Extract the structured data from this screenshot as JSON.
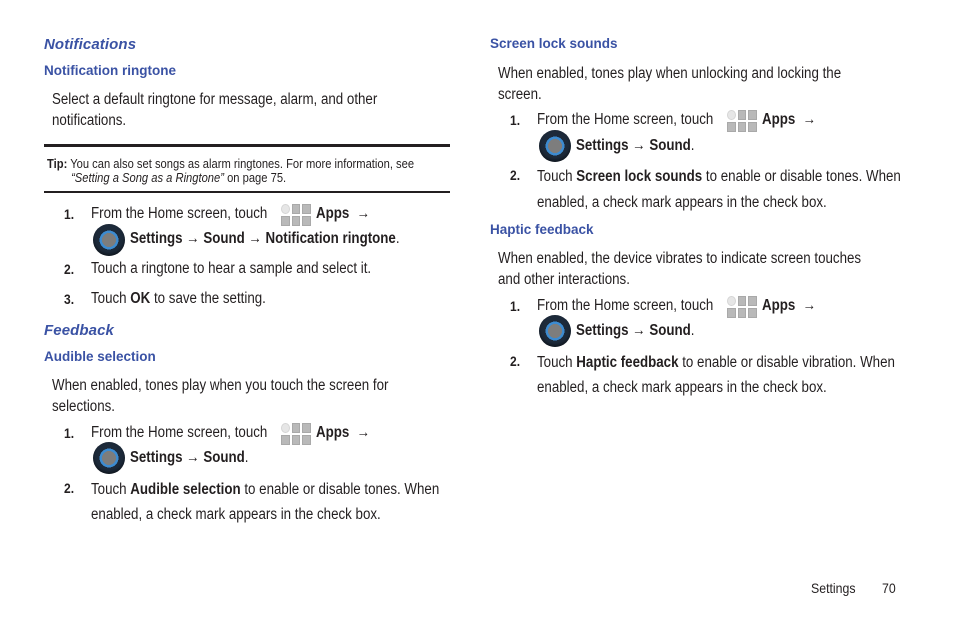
{
  "left": {
    "notifications": {
      "heading": "Notifications",
      "subheading": "Notification ringtone",
      "description_lines": [
        "Select a default ringtone for message, alarm, and other",
        "notifications."
      ],
      "tip": {
        "label": "Tip:",
        "line1": "You can also set songs as alarm ringtones. For more information, see",
        "link": "“Setting a Song as a Ringtone”",
        "line2_rest": " on page 75."
      },
      "steps": [
        {
          "num": "1.",
          "text_a": "From the Home screen, touch",
          "apps": "Apps",
          "arrow": "→",
          "path": "Settings → Sound → Notification ringtone",
          "end": "."
        },
        {
          "num": "2.",
          "text": "Touch a ringtone to hear a sample and select it."
        },
        {
          "num": "3.",
          "pre": "Touch ",
          "bold": "OK",
          "post": " to save the setting."
        }
      ]
    },
    "feedback": {
      "heading": "Feedback",
      "subheading": "Audible selection",
      "description_lines": [
        "When enabled, tones play when you touch the screen for",
        "selections."
      ],
      "steps": [
        {
          "num": "1.",
          "text_a": "From the Home screen, touch",
          "apps": "Apps",
          "arrow": "→",
          "path": "Settings → Sound",
          "end": "."
        },
        {
          "num": "2.",
          "pre": "Touch ",
          "bold": "Audible selection",
          "post": " to enable or disable tones. When",
          "line2": "enabled, a check mark appears in the check box."
        }
      ]
    }
  },
  "right": {
    "screen_lock": {
      "subheading": "Screen lock sounds",
      "description_lines": [
        "When enabled, tones play when unlocking and locking the",
        "screen."
      ],
      "steps": [
        {
          "num": "1.",
          "text_a": "From the Home screen, touch",
          "apps": "Apps",
          "arrow": "→",
          "path": "Settings → Sound",
          "end": "."
        },
        {
          "num": "2.",
          "pre": "Touch ",
          "bold": "Screen lock sounds",
          "post": " to enable or disable tones. When",
          "line2": "enabled, a check mark appears in the check box."
        }
      ]
    },
    "haptic": {
      "subheading": "Haptic feedback",
      "description_lines": [
        "When enabled, the device vibrates to indicate screen touches",
        "and other interactions."
      ],
      "steps": [
        {
          "num": "1.",
          "text_a": "From the Home screen, touch",
          "apps": "Apps",
          "arrow": "→",
          "path": "Settings → Sound",
          "end": "."
        },
        {
          "num": "2.",
          "pre": "Touch ",
          "bold": "Haptic feedback",
          "post": " to enable or disable vibration. When",
          "line2": "enabled, a check mark appears in the check box."
        }
      ]
    }
  },
  "footer": {
    "section": "Settings",
    "page": "70"
  },
  "icons": {
    "apps": "apps-grid-icon",
    "settings": "settings-dial-icon"
  },
  "colors": {
    "heading": "#3a52a4",
    "text": "#231f20"
  }
}
